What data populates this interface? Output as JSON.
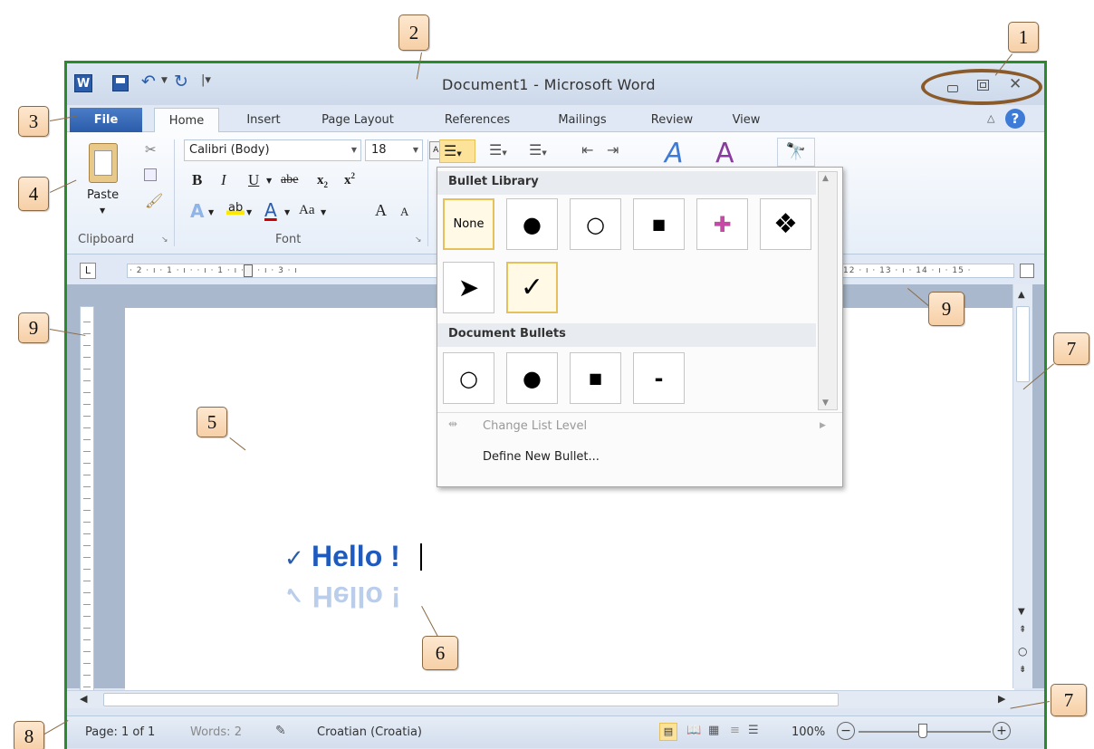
{
  "title": "Document1 - Microsoft Word",
  "app_icon": "W",
  "tabs": [
    {
      "label": "File"
    },
    {
      "label": "Home"
    },
    {
      "label": "Insert"
    },
    {
      "label": "Page Layout"
    },
    {
      "label": "References"
    },
    {
      "label": "Mailings"
    },
    {
      "label": "Review"
    },
    {
      "label": "View"
    }
  ],
  "clipboard": {
    "paste_label": "Paste",
    "group_label": "Clipboard"
  },
  "font": {
    "name": "Calibri (Body)",
    "size": "18",
    "group_label": "Font",
    "bold": "B",
    "italic": "I",
    "underline": "U",
    "strike": "abe",
    "grow": "A",
    "change_case": "Aa"
  },
  "ruler_text": "· 2 · ı · 1 · ı ·   · ı · 1 · ı · 2 · ı · 3 · ı",
  "ruler_right_text": "12 · ı · 13 · ı · 14 · ı · 15 ·",
  "dropdown": {
    "library_header": "Bullet Library",
    "none_label": "None",
    "library": [
      "●",
      "○",
      "■",
      "✚",
      "❖",
      "➤",
      "✓"
    ],
    "doc_header": "Document Bullets",
    "doc_bullets": [
      "○",
      "●",
      "■",
      "-"
    ],
    "change_level": "Change List Level",
    "define_new": "Define New Bullet..."
  },
  "document": {
    "text": "Hello !",
    "bullet": "✓"
  },
  "status": {
    "page": "Page: 1 of 1",
    "words": "Words: 2",
    "language": "Croatian (Croatia)",
    "zoom": "100%"
  },
  "callouts": [
    "1",
    "2",
    "3",
    "4",
    "5",
    "6",
    "7",
    "8",
    "9"
  ],
  "colors": {
    "frame": "#2b8a2b",
    "file_tab": "#2a5caa",
    "selected": "#e6c15b",
    "callout_circle": "#8a5a2b"
  }
}
